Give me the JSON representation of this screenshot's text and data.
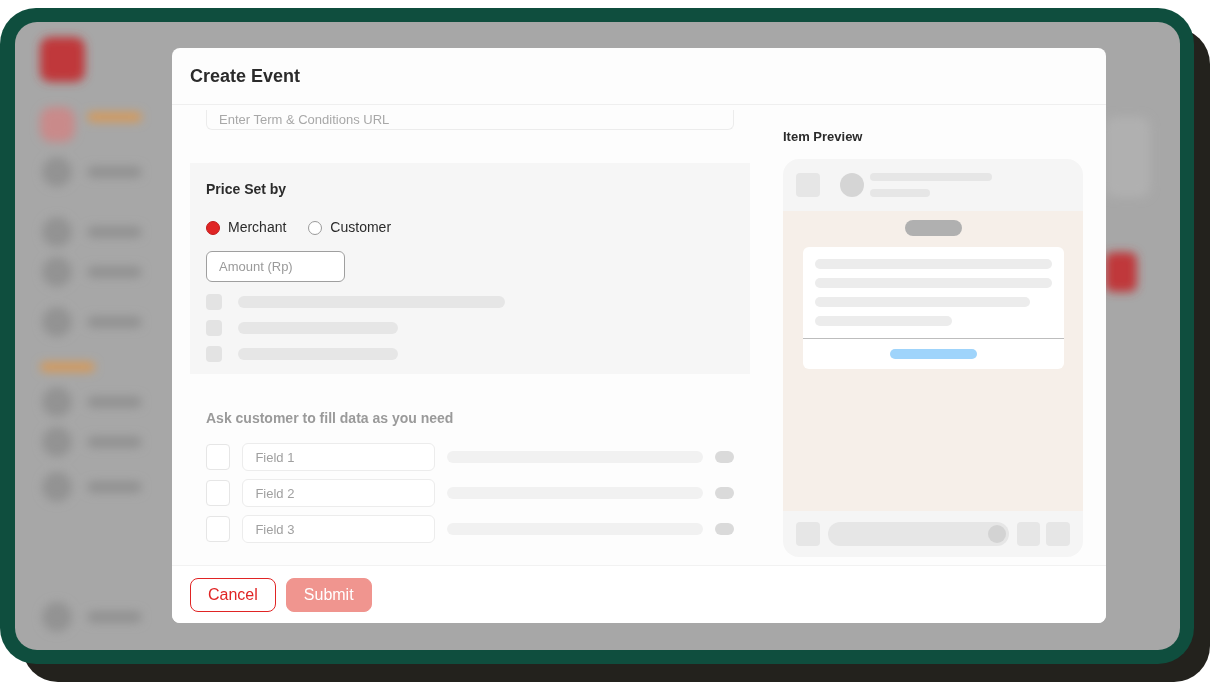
{
  "dialog": {
    "title": "Create Event"
  },
  "terms_field": {
    "placeholder": "Enter Term & Conditions URL"
  },
  "price_section": {
    "title": "Price Set by",
    "options": [
      {
        "label": "Merchant",
        "selected": true
      },
      {
        "label": "Customer",
        "selected": false
      }
    ],
    "amount_field": {
      "placeholder": "Amount (Rp)"
    }
  },
  "custom_fields": {
    "title": "Ask customer to fill data as you need",
    "disabled": true,
    "fields": [
      {
        "placeholder": "Field 1",
        "checked": false
      },
      {
        "placeholder": "Field 2",
        "checked": false
      },
      {
        "placeholder": "Field 3",
        "checked": false
      }
    ]
  },
  "preview": {
    "title": "Item Preview"
  },
  "buttons": [
    {
      "label": "Cancel",
      "kind": "secondary",
      "disabled": false
    },
    {
      "label": "Submit",
      "kind": "primary",
      "disabled": true
    }
  ]
}
